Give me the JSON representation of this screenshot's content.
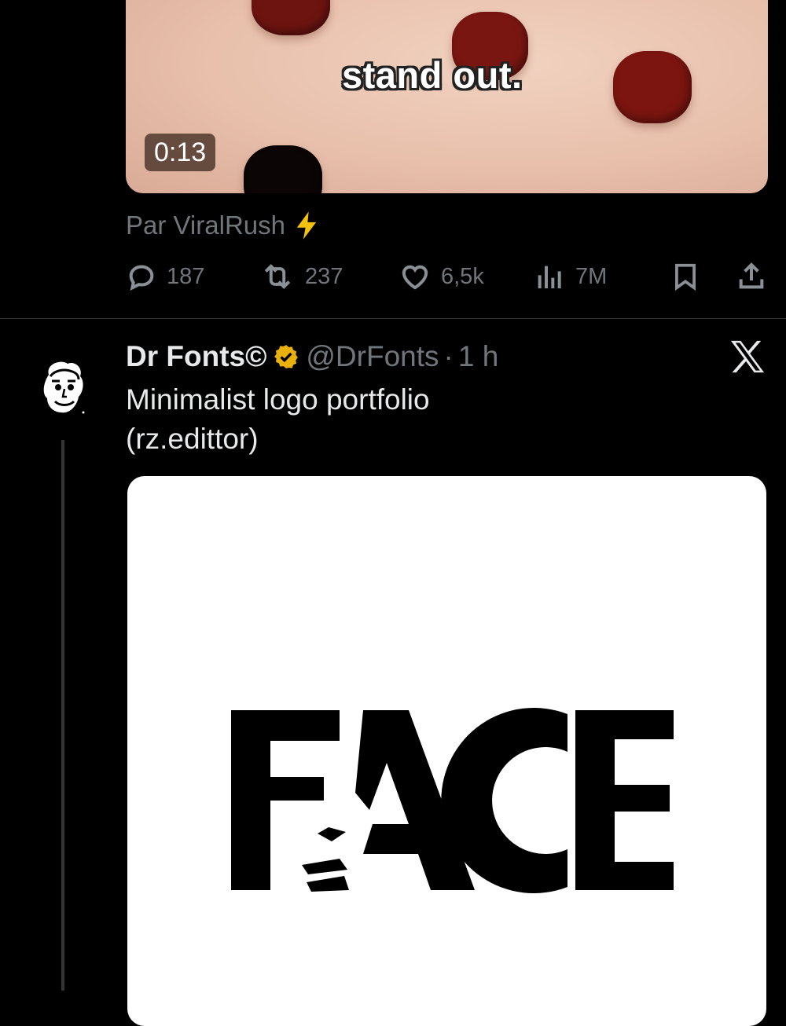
{
  "previous_tweet": {
    "video": {
      "subtitle": "stand out.",
      "duration": "0:13"
    },
    "source_label": "Par ViralRush",
    "source_icon": "lightning-icon",
    "stats": {
      "replies": "187",
      "reposts": "237",
      "likes": "6,5k",
      "views": "7M"
    }
  },
  "tweet": {
    "author_name": "Dr Fonts©",
    "handle": "@DrFonts",
    "separator": "·",
    "time": "1 h",
    "text_line1": "Minimalist logo portfolio",
    "text_line2": "(rz.edittor)",
    "media": {
      "logo_text": "FACE"
    }
  },
  "colors": {
    "background": "#000000",
    "text_primary": "#e7e9ea",
    "text_secondary": "#71767b",
    "verified_badge": "#e8b10c",
    "divider": "#2f3336"
  }
}
